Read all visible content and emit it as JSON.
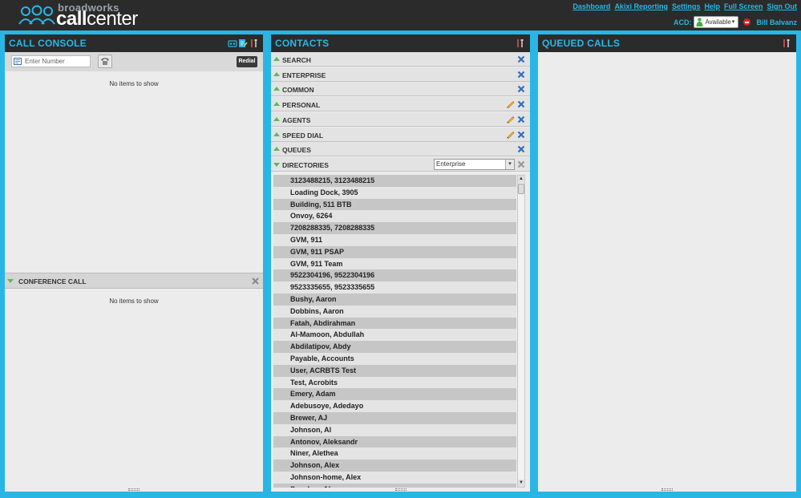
{
  "header": {
    "logo_top": "broadworks",
    "logo_main_a": "call",
    "logo_main_b": "center",
    "nav": [
      "Dashboard",
      "Akixi Reporting",
      "Settings",
      "Help",
      "Full Screen",
      "Sign Out"
    ],
    "acd_label": "ACD:",
    "acd_status": "Available",
    "user_name": "Bill Balvanz"
  },
  "console": {
    "title": "CALL CONSOLE",
    "number_placeholder": "Enter Number",
    "redial_label": "Redial",
    "empty_message": "No items to show",
    "conference_title": "CONFERENCE CALL",
    "conference_empty": "No items to show"
  },
  "contacts": {
    "title": "CONTACTS",
    "groups": [
      {
        "label": "SEARCH",
        "editable": false
      },
      {
        "label": "ENTERPRISE",
        "editable": false
      },
      {
        "label": "COMMON",
        "editable": false
      },
      {
        "label": "PERSONAL",
        "editable": true
      },
      {
        "label": "AGENTS",
        "editable": true
      },
      {
        "label": "SPEED DIAL",
        "editable": true
      },
      {
        "label": "QUEUES",
        "editable": false
      }
    ],
    "directories_label": "DIRECTORIES",
    "directory_selected": "Enterprise",
    "directory_entries": [
      "3123488215, 3123488215",
      "Loading Dock, 3905",
      "Building, 511 BTB",
      "Onvoy, 6264",
      "7208288335, 7208288335",
      "GVM, 911",
      "GVM, 911 PSAP",
      "GVM, 911 Team",
      "9522304196, 9522304196",
      "9523335655, 9523335655",
      "Bushy, Aaron",
      "Dobbins, Aaron",
      "Fatah, Abdirahman",
      "Al-Mamoon, Abdullah",
      "Abdilatipov, Abdy",
      "Payable, Accounts",
      "User, ACRBTS Test",
      "Test, Acrobits",
      "Emery, Adam",
      "Adebusoye, Adedayo",
      "Brewer, AJ",
      "Johnson, Al",
      "Antonov, Aleksandr",
      "Niner, Alethea",
      "Johnson, Alex",
      "Johnson-home, Alex",
      "Sanchez, Alex"
    ]
  },
  "queued": {
    "title": "QUEUED CALLS"
  },
  "colors": {
    "accent": "#29b6e6",
    "header_bg": "#2b2b2b",
    "available_green": "#3cb043",
    "dnd_red": "#dd2222"
  }
}
